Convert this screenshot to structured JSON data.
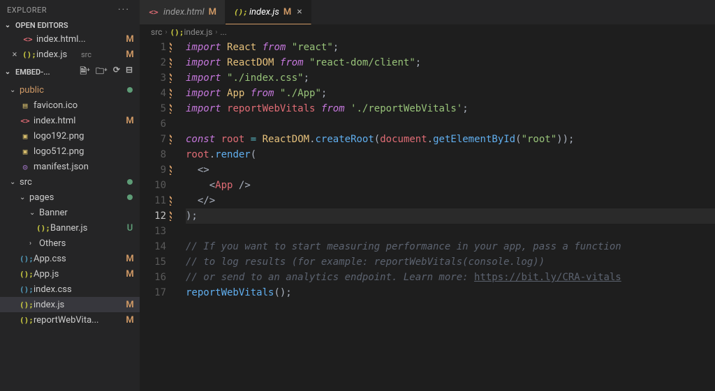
{
  "sidebar": {
    "title": "EXPLORER",
    "sections": {
      "open_editors": {
        "label": "OPEN EDITORS",
        "items": [
          {
            "icon": "<>",
            "icon_class": "ic-html",
            "name": "index.html...",
            "badge": "M",
            "close": ""
          },
          {
            "icon": "();",
            "icon_class": "ic-js",
            "name": "index.js",
            "sec": "src",
            "badge": "M",
            "close": "×"
          }
        ]
      },
      "folder": {
        "label": "EMBED-...",
        "tree": [
          {
            "type": "folder",
            "name": "public",
            "depth": 1,
            "open": true,
            "class": "pub",
            "dot": true
          },
          {
            "type": "file",
            "icon": "▤",
            "icon_class": "ic-img",
            "name": "favicon.ico",
            "depth": 2
          },
          {
            "type": "file",
            "icon": "<>",
            "icon_class": "ic-html",
            "name": "index.html",
            "depth": 2,
            "badge": "M"
          },
          {
            "type": "file",
            "icon": "▣",
            "icon_class": "ic-img",
            "name": "logo192.png",
            "depth": 2
          },
          {
            "type": "file",
            "icon": "▣",
            "icon_class": "ic-img",
            "name": "logo512.png",
            "depth": 2
          },
          {
            "type": "file",
            "icon": "◎",
            "icon_class": "ic-json",
            "name": "manifest.json",
            "depth": 2
          },
          {
            "type": "folder",
            "name": "src",
            "depth": 1,
            "open": true,
            "dot": true
          },
          {
            "type": "folder",
            "name": "pages",
            "depth": 2,
            "open": true,
            "dot": true
          },
          {
            "type": "folder",
            "name": "Banner",
            "depth": 3,
            "open": true
          },
          {
            "type": "file",
            "icon": "();",
            "icon_class": "ic-js",
            "name": "Banner.js",
            "depth": 4,
            "badge": "U",
            "badge_class": "u"
          },
          {
            "type": "folder",
            "name": "Others",
            "depth": 3,
            "open": false
          },
          {
            "type": "file",
            "icon": "();",
            "icon_class": "ic-css",
            "name": "App.css",
            "depth": 2,
            "badge": "M"
          },
          {
            "type": "file",
            "icon": "();",
            "icon_class": "ic-js",
            "name": "App.js",
            "depth": 2,
            "badge": "M"
          },
          {
            "type": "file",
            "icon": "();",
            "icon_class": "ic-css",
            "name": "index.css",
            "depth": 2
          },
          {
            "type": "file",
            "icon": "();",
            "icon_class": "ic-js",
            "name": "index.js",
            "depth": 2,
            "badge": "M",
            "selected": true
          },
          {
            "type": "file",
            "icon": "();",
            "icon_class": "ic-js",
            "name": "reportWebVita...",
            "depth": 2,
            "badge": "M"
          }
        ]
      }
    }
  },
  "tabs": [
    {
      "icon": "<>",
      "icon_class": "ic-html",
      "label": "index.html",
      "badge": "M",
      "active": false
    },
    {
      "icon": "();",
      "icon_class": "ic-js",
      "label": "index.js",
      "badge": "M",
      "active": true,
      "close": "×"
    }
  ],
  "breadcrumb": {
    "parts": [
      "src",
      "index.js",
      "..."
    ],
    "icon": "();"
  },
  "code": {
    "current_line": 12,
    "lines": [
      {
        "n": 1,
        "mod": true,
        "tokens": [
          [
            "tok-kw",
            "import"
          ],
          [
            "",
            " "
          ],
          [
            "tok-name",
            "React"
          ],
          [
            "",
            " "
          ],
          [
            "tok-kw",
            "from"
          ],
          [
            "",
            " "
          ],
          [
            "tok-str",
            "\"react\""
          ],
          [
            "tok-punc",
            ";"
          ]
        ]
      },
      {
        "n": 2,
        "mod": true,
        "tokens": [
          [
            "tok-kw",
            "import"
          ],
          [
            "",
            " "
          ],
          [
            "tok-name",
            "ReactDOM"
          ],
          [
            "",
            " "
          ],
          [
            "tok-kw",
            "from"
          ],
          [
            "",
            " "
          ],
          [
            "tok-str",
            "\"react-dom/client\""
          ],
          [
            "tok-punc",
            ";"
          ]
        ]
      },
      {
        "n": 3,
        "mod": true,
        "tokens": [
          [
            "tok-kw",
            "import"
          ],
          [
            "",
            " "
          ],
          [
            "tok-str",
            "\"./index.css\""
          ],
          [
            "tok-punc",
            ";"
          ]
        ]
      },
      {
        "n": 4,
        "mod": true,
        "tokens": [
          [
            "tok-kw",
            "import"
          ],
          [
            "",
            " "
          ],
          [
            "tok-name",
            "App"
          ],
          [
            "",
            " "
          ],
          [
            "tok-kw",
            "from"
          ],
          [
            "",
            " "
          ],
          [
            "tok-str",
            "\"./App\""
          ],
          [
            "tok-punc",
            ";"
          ]
        ]
      },
      {
        "n": 5,
        "mod": true,
        "tokens": [
          [
            "tok-kw",
            "import"
          ],
          [
            "",
            " "
          ],
          [
            "tok-var",
            "reportWebVitals"
          ],
          [
            "",
            " "
          ],
          [
            "tok-kw",
            "from"
          ],
          [
            "",
            " "
          ],
          [
            "tok-str",
            "'./reportWebVitals'"
          ],
          [
            "tok-punc",
            ";"
          ]
        ]
      },
      {
        "n": 6,
        "tokens": []
      },
      {
        "n": 7,
        "mod": true,
        "tokens": [
          [
            "tok-kw",
            "const"
          ],
          [
            "",
            " "
          ],
          [
            "tok-var",
            "root"
          ],
          [
            "",
            " "
          ],
          [
            "tok-op",
            "="
          ],
          [
            "",
            " "
          ],
          [
            "tok-name",
            "ReactDOM"
          ],
          [
            "tok-punc",
            "."
          ],
          [
            "tok-fn",
            "createRoot"
          ],
          [
            "tok-punc",
            "("
          ],
          [
            "tok-var",
            "document"
          ],
          [
            "tok-punc",
            "."
          ],
          [
            "tok-fn",
            "getElementById"
          ],
          [
            "tok-punc",
            "("
          ],
          [
            "tok-str",
            "\"root\""
          ],
          [
            "tok-punc",
            "));"
          ]
        ]
      },
      {
        "n": 8,
        "tokens": [
          [
            "tok-var",
            "root"
          ],
          [
            "tok-punc",
            "."
          ],
          [
            "tok-fn",
            "render"
          ],
          [
            "tok-punc",
            "("
          ]
        ]
      },
      {
        "n": 9,
        "mod": true,
        "tokens": [
          [
            "",
            "  "
          ],
          [
            "tok-jsxp",
            "<>"
          ]
        ]
      },
      {
        "n": 10,
        "tokens": [
          [
            "",
            "    "
          ],
          [
            "tok-jsxp",
            "<"
          ],
          [
            "tok-tag",
            "App"
          ],
          [
            "",
            " "
          ],
          [
            "tok-jsxp",
            "/>"
          ]
        ]
      },
      {
        "n": 11,
        "mod": true,
        "tokens": [
          [
            "",
            "  "
          ],
          [
            "tok-jsxp",
            "</>"
          ]
        ]
      },
      {
        "n": 12,
        "mod": true,
        "hl": true,
        "tokens": [
          [
            "tok-punc",
            ");"
          ]
        ]
      },
      {
        "n": 13,
        "tokens": []
      },
      {
        "n": 14,
        "tokens": [
          [
            "tok-cmt",
            "// If you want to start measuring performance in your app, pass a function"
          ]
        ]
      },
      {
        "n": 15,
        "tokens": [
          [
            "tok-cmt",
            "// to log results (for example: reportWebVitals(console.log))"
          ]
        ]
      },
      {
        "n": 16,
        "tokens": [
          [
            "tok-cmt",
            "// or send to an analytics endpoint. Learn more: "
          ],
          [
            "tok-cmtlink",
            "https://bit.ly/CRA-vitals"
          ]
        ]
      },
      {
        "n": 17,
        "tokens": [
          [
            "tok-fn",
            "reportWebVitals"
          ],
          [
            "tok-punc",
            "();"
          ]
        ]
      }
    ]
  }
}
